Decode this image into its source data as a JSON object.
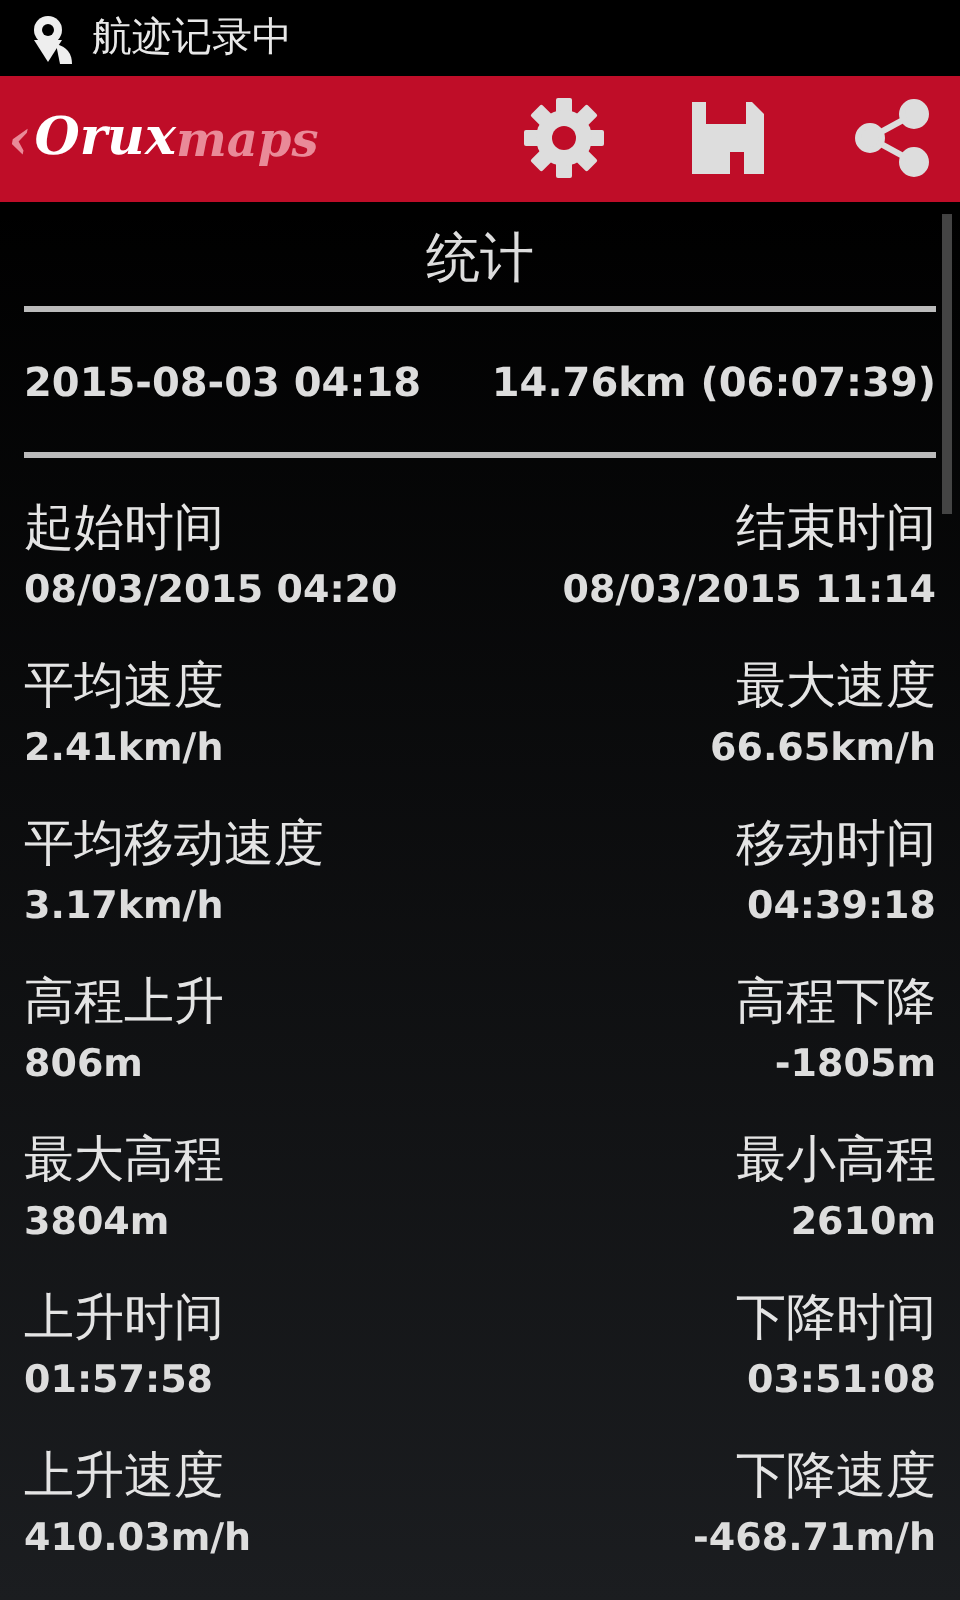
{
  "status_bar": {
    "notification": "航迹记录中"
  },
  "app_bar": {
    "back": "‹",
    "logo_main": "Orux",
    "logo_sub": "maps"
  },
  "title": "统计",
  "summary": {
    "date": "2015-08-03 04:18",
    "distance": "14.76km (06:07:39)"
  },
  "stats": [
    {
      "left_label": "起始时间",
      "left_value": "08/03/2015 04:20",
      "right_label": "结束时间",
      "right_value": "08/03/2015 11:14"
    },
    {
      "left_label": "平均速度",
      "left_value": "2.41km/h",
      "right_label": "最大速度",
      "right_value": "66.65km/h"
    },
    {
      "left_label": "平均移动速度",
      "left_value": "3.17km/h",
      "right_label": "移动时间",
      "right_value": "04:39:18"
    },
    {
      "left_label": "高程上升",
      "left_value": "806m",
      "right_label": "高程下降",
      "right_value": "-1805m"
    },
    {
      "left_label": "最大高程",
      "left_value": "3804m",
      "right_label": "最小高程",
      "right_value": "2610m"
    },
    {
      "left_label": "上升时间",
      "left_value": "01:57:58",
      "right_label": "下降时间",
      "right_value": "03:51:08"
    },
    {
      "left_label": "上升速度",
      "left_value": "410.03m/h",
      "right_label": "下降速度",
      "right_value": "-468.71m/h"
    }
  ]
}
